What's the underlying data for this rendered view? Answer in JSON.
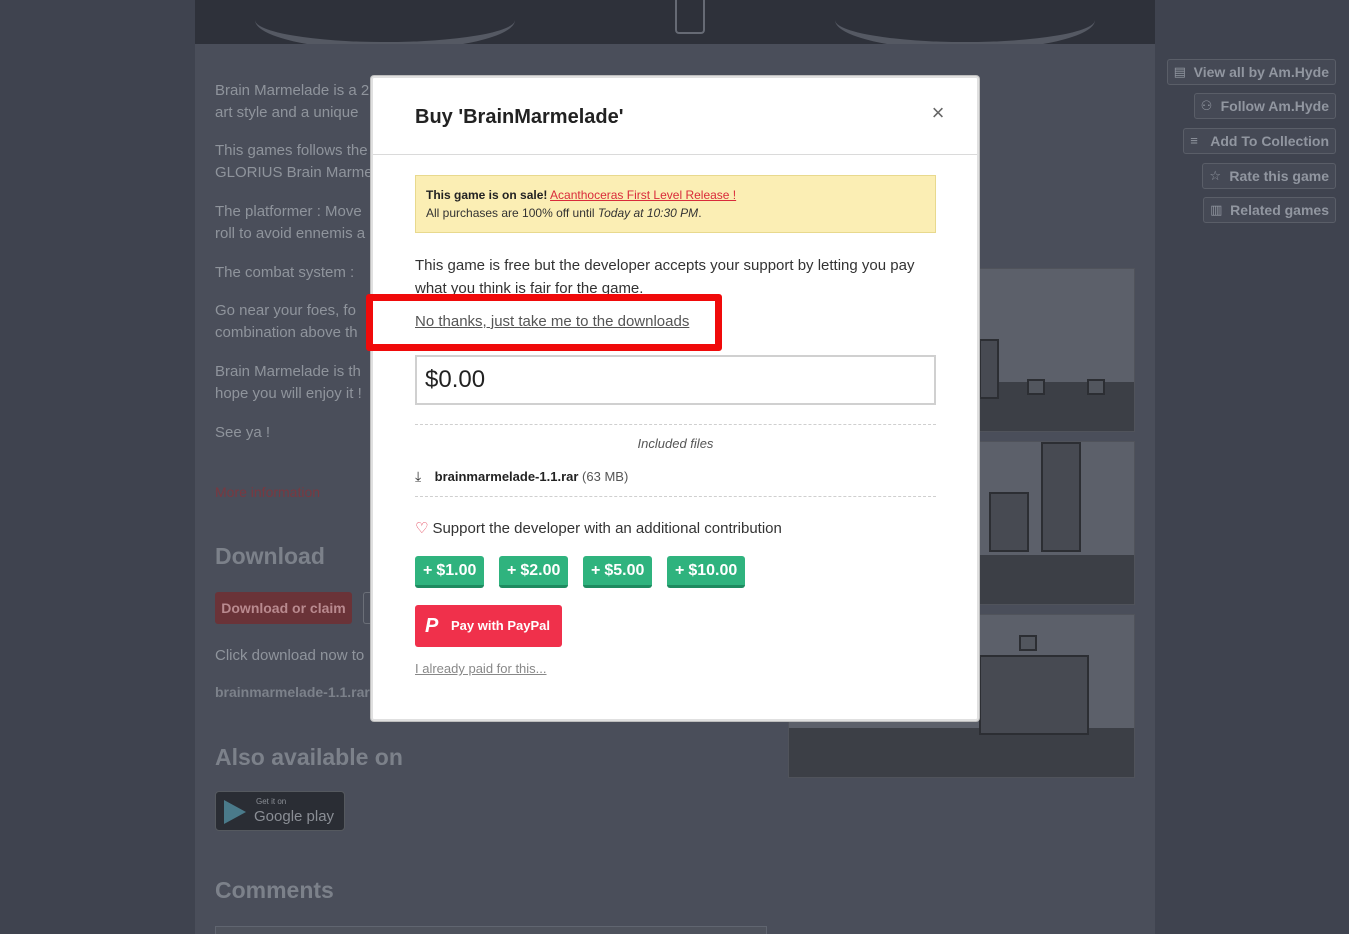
{
  "background": {
    "paragraphs": [
      "Brain Marmelade is a 2",
      "art style and a unique",
      "This games follows the",
      "GLORIUS Brain Marme",
      "The platformer : Move",
      "roll to avoid ennemis a",
      "The combat system :",
      "Go near your foes, fo",
      "combination above th",
      "Brain Marmelade is th",
      "hope you will enjoy it !",
      "See ya !"
    ],
    "more_info": "More information",
    "download_heading": "Download",
    "download_button": "Download or claim",
    "download_hint": "Click download now to",
    "filename": "brainmarmelade-1.1.rar",
    "also_available_heading": "Also available on",
    "gplay_small": "Get it on",
    "gplay_big": "Google play",
    "comments_heading": "Comments"
  },
  "sidebar": {
    "view_all": "View all by Am.Hyde",
    "follow": "Follow Am.Hyde",
    "add_collection": "Add To Collection",
    "rate": "Rate this game",
    "related": "Related games"
  },
  "modal": {
    "title": "Buy 'BrainMarmelade'",
    "close_glyph": "×",
    "sale": {
      "prefix": "This game is on sale!",
      "link": "Acanthoceras First Level Release !",
      "line2_prefix": "All purchases are 100% off until",
      "until": "Today at 10:30 PM",
      "line2_suffix": "."
    },
    "free_message": "This game is free but the developer accepts your support by letting you pay what you think is fair for the game.",
    "no_thanks": "No thanks, just take me to the downloads",
    "price_value": "$0.00",
    "included_files_label": "Included files",
    "file": {
      "name": "brainmarmelade-1.1.rar",
      "size": "(63 MB)"
    },
    "support_text": "Support the developer with an additional contribution",
    "tips": [
      "$1.00",
      "$2.00",
      "$5.00",
      "$10.00"
    ],
    "paypal_label": "Pay with PayPal",
    "already_paid": "I already paid for this..."
  },
  "colors": {
    "highlight": "#f00a0a",
    "tip_green": "#2fb37e",
    "paypal_red": "#f0304b",
    "sale_bg": "#fbeeb4",
    "sale_link": "#d92b3a"
  }
}
